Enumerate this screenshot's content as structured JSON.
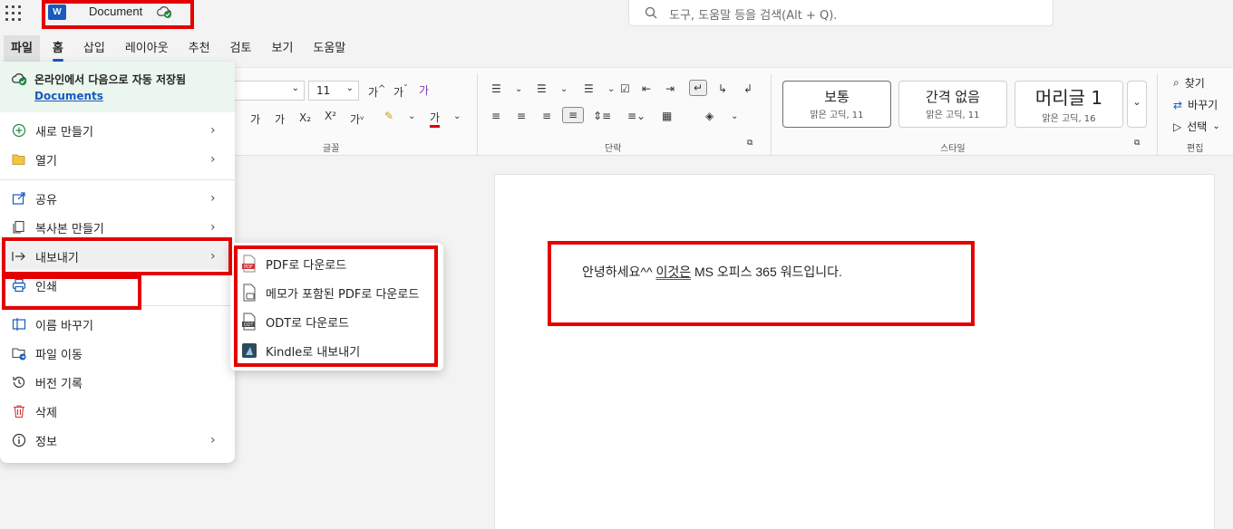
{
  "app": {
    "doc_name": "Document",
    "logo_letter": "W"
  },
  "search": {
    "placeholder": "도구, 도움말 등을 검색(Alt + Q)."
  },
  "tabs": [
    "파일",
    "홈",
    "삽입",
    "레이아웃",
    "추천",
    "검토",
    "보기",
    "도움말"
  ],
  "ribbon": {
    "font_size": "11",
    "group_labels": {
      "font": "글꼴",
      "paragraph": "단락",
      "styles": "스타일",
      "editing": "편집"
    },
    "styles": [
      {
        "name": "보통",
        "font": "맑은 고딕, 11"
      },
      {
        "name": "간격 없음",
        "font": "맑은 고딕, 11"
      },
      {
        "name": "머리글 1",
        "font": "맑은 고딕, 16"
      }
    ],
    "editing": {
      "find": "찾기",
      "replace": "바꾸기",
      "select": "선택"
    }
  },
  "file_menu": {
    "autosave_message": "온라인에서 다음으로 자동 저장됨",
    "autosave_location": "Documents",
    "items": {
      "new": "새로 만들기",
      "open": "열기",
      "share": "공유",
      "copy": "복사본 만들기",
      "export": "내보내기",
      "print": "인쇄",
      "rename": "이름 바꾸기",
      "move": "파일 이동",
      "version": "버전 기록",
      "delete": "삭제",
      "info": "정보"
    }
  },
  "export_submenu": {
    "pdf": "PDF로 다운로드",
    "pdf_comments": "메모가 포함된 PDF로 다운로드",
    "odt": "ODT로 다운로드",
    "kindle": "Kindle로 내보내기"
  },
  "document": {
    "text_before": "안녕하세요^^ ",
    "text_underlined": "이것은",
    "text_after": " MS 오피스 365 워드입니다."
  },
  "colors": {
    "accent": "#185abd",
    "highlight": "#e50000",
    "autosave_bg": "#eaf6ee"
  }
}
